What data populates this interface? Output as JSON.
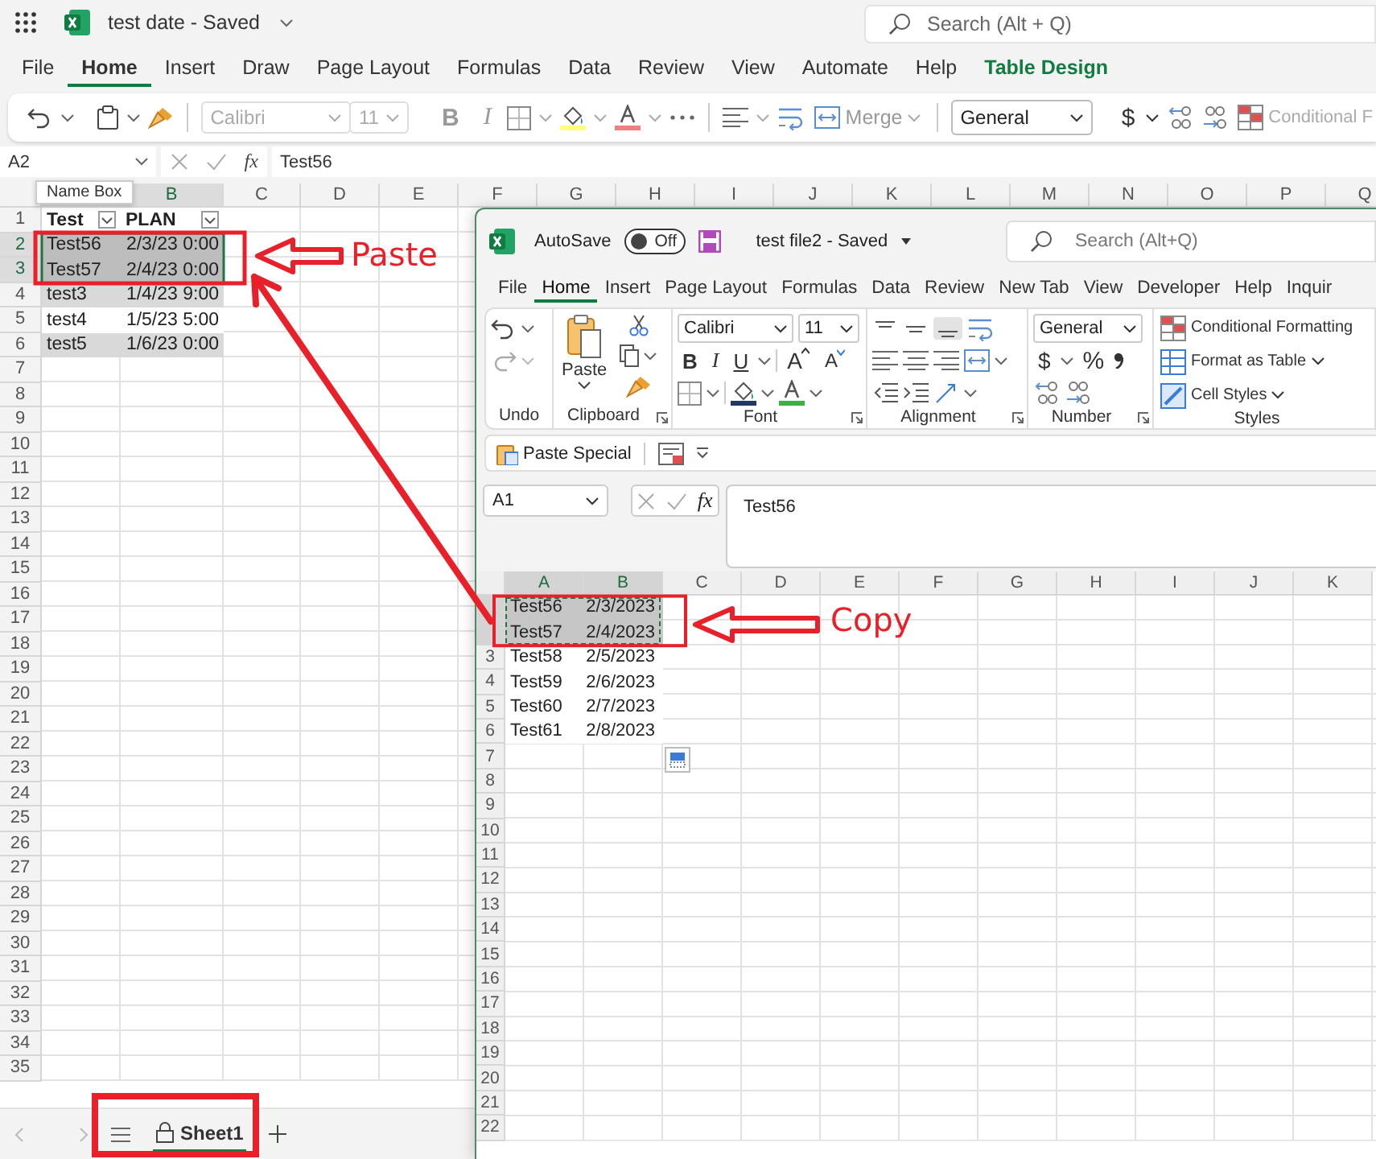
{
  "back_window": {
    "title": "test date - Saved",
    "search": {
      "placeholder": "Search (Alt + Q)"
    },
    "tabs": [
      {
        "label": "File",
        "selected": false,
        "kind": "normal"
      },
      {
        "label": "Home",
        "selected": true,
        "kind": "normal"
      },
      {
        "label": "Insert",
        "selected": false,
        "kind": "normal"
      },
      {
        "label": "Draw",
        "selected": false,
        "kind": "normal"
      },
      {
        "label": "Page Layout",
        "selected": false,
        "kind": "normal"
      },
      {
        "label": "Formulas",
        "selected": false,
        "kind": "normal"
      },
      {
        "label": "Data",
        "selected": false,
        "kind": "normal"
      },
      {
        "label": "Review",
        "selected": false,
        "kind": "normal"
      },
      {
        "label": "View",
        "selected": false,
        "kind": "normal"
      },
      {
        "label": "Automate",
        "selected": false,
        "kind": "normal"
      },
      {
        "label": "Help",
        "selected": false,
        "kind": "normal"
      },
      {
        "label": "Table Design",
        "selected": false,
        "kind": "contextual"
      }
    ],
    "toolbar": {
      "font": "Calibri",
      "size": "11",
      "font_buttons": [
        "B",
        "I"
      ],
      "merge": "Merge",
      "number_format": "General",
      "currency": "$",
      "conditional": "Conditional F"
    },
    "name_box": "A2",
    "function_label": "fx",
    "formula": "Test56",
    "tooltip": "Name Box",
    "sheet": {
      "columns": [
        {
          "selected": true
        },
        {
          "label": "B",
          "selected": true
        },
        {
          "label": "C",
          "selected": false
        },
        {
          "label": "D",
          "selected": false
        },
        {
          "label": "E",
          "selected": false
        },
        {
          "label": "F",
          "selected": false
        },
        {
          "label": "G",
          "selected": false
        },
        {
          "label": "H",
          "selected": false
        },
        {
          "label": "I",
          "selected": false
        },
        {
          "label": "J",
          "selected": false
        },
        {
          "label": "K",
          "selected": false
        },
        {
          "label": "L",
          "selected": false
        },
        {
          "label": "M",
          "selected": false
        },
        {
          "label": "N",
          "selected": false
        },
        {
          "label": "O",
          "selected": false
        },
        {
          "label": "P",
          "selected": false
        },
        {
          "label": "Q",
          "selected": false
        }
      ],
      "rows": [
        {
          "label": "1",
          "selected": false,
          "kind": "header",
          "cells": [
            "Test",
            "PLAN"
          ]
        },
        {
          "label": "2",
          "selected": true,
          "kind": "band",
          "cells": [
            "Test56",
            "2/3/23 0:00"
          ]
        },
        {
          "label": "3",
          "selected": true,
          "kind": "plain",
          "cells": [
            "Test57",
            "2/4/23 0:00"
          ]
        },
        {
          "label": "4",
          "selected": false,
          "kind": "band",
          "cells": [
            "test3",
            "1/4/23 9:00"
          ]
        },
        {
          "label": "5",
          "selected": false,
          "kind": "plain",
          "cells": [
            "test4",
            "1/5/23 5:00"
          ]
        },
        {
          "label": "6",
          "selected": false,
          "kind": "band",
          "cells": [
            "test5",
            "1/6/23 0:00"
          ]
        },
        {
          "label": "7",
          "selected": false
        },
        {
          "label": "8",
          "selected": false
        },
        {
          "label": "9",
          "selected": false
        },
        {
          "label": "10",
          "selected": false
        },
        {
          "label": "11",
          "selected": false
        },
        {
          "label": "12",
          "selected": false
        },
        {
          "label": "13",
          "selected": false
        },
        {
          "label": "14",
          "selected": false
        },
        {
          "label": "15",
          "selected": false
        },
        {
          "label": "16",
          "selected": false
        },
        {
          "label": "17",
          "selected": false
        },
        {
          "label": "18",
          "selected": false
        },
        {
          "label": "19",
          "selected": false
        },
        {
          "label": "20",
          "selected": false
        },
        {
          "label": "21",
          "selected": false
        },
        {
          "label": "22",
          "selected": false
        },
        {
          "label": "23",
          "selected": false
        },
        {
          "label": "24",
          "selected": false
        },
        {
          "label": "25",
          "selected": false
        },
        {
          "label": "26",
          "selected": false
        },
        {
          "label": "27",
          "selected": false
        },
        {
          "label": "28",
          "selected": false
        },
        {
          "label": "29",
          "selected": false
        },
        {
          "label": "30",
          "selected": false
        },
        {
          "label": "31",
          "selected": false
        },
        {
          "label": "32",
          "selected": false
        },
        {
          "label": "33",
          "selected": false
        },
        {
          "label": "34",
          "selected": false
        },
        {
          "label": "35",
          "selected": false
        }
      ]
    },
    "sheet_tabs": [
      {
        "label": "Sheet1",
        "selected": true
      }
    ]
  },
  "front_window": {
    "autosave": {
      "label": "AutoSave",
      "on": false,
      "state_label": "Off"
    },
    "title": "test file2 - Saved",
    "search": {
      "placeholder": "Search (Alt+Q)"
    },
    "tabs": [
      {
        "label": "File",
        "selected": false
      },
      {
        "label": "Home",
        "selected": true
      },
      {
        "label": "Insert",
        "selected": false
      },
      {
        "label": "Page Layout",
        "selected": false
      },
      {
        "label": "Formulas",
        "selected": false
      },
      {
        "label": "Data",
        "selected": false
      },
      {
        "label": "Review",
        "selected": false
      },
      {
        "label": "New Tab",
        "selected": false
      },
      {
        "label": "View",
        "selected": false
      },
      {
        "label": "Developer",
        "selected": false
      },
      {
        "label": "Help",
        "selected": false
      },
      {
        "label": "Inquir",
        "selected": false
      }
    ],
    "ribbon": {
      "paste": "Paste",
      "font": "Calibri",
      "size": "11",
      "font_buttons": [
        "B",
        "I",
        "U"
      ],
      "grow_font": "A",
      "shrink_font": "A",
      "number_format": "General",
      "currency": "$",
      "percent": "%",
      "styles": [
        "Conditional Formatting",
        "Format as Table",
        "Cell Styles"
      ],
      "groups": [
        "Undo",
        "Clipboard",
        "Font",
        "Alignment",
        "Number",
        "Styles"
      ]
    },
    "quick_access": {
      "paste_special": "Paste Special"
    },
    "name_box": "A1",
    "function_label": "fx",
    "formula": "Test56",
    "sheet": {
      "columns": [
        {
          "label": "A",
          "selected": true
        },
        {
          "label": "B",
          "selected": true
        },
        {
          "label": "C",
          "selected": false
        },
        {
          "label": "D",
          "selected": false
        },
        {
          "label": "E",
          "selected": false
        },
        {
          "label": "F",
          "selected": false
        },
        {
          "label": "G",
          "selected": false
        },
        {
          "label": "H",
          "selected": false
        },
        {
          "label": "I",
          "selected": false
        },
        {
          "label": "J",
          "selected": false
        },
        {
          "label": "K",
          "selected": false
        }
      ],
      "rows": [
        {
          "selected": true,
          "cells": [
            "Test56",
            "2/3/2023"
          ]
        },
        {
          "selected": true,
          "cells": [
            "Test57",
            "2/4/2023"
          ]
        },
        {
          "label": "3",
          "selected": false,
          "cells": [
            "Test58",
            "2/5/2023"
          ]
        },
        {
          "label": "4",
          "selected": false,
          "cells": [
            "Test59",
            "2/6/2023"
          ]
        },
        {
          "label": "5",
          "selected": false,
          "cells": [
            "Test60",
            "2/7/2023"
          ]
        },
        {
          "label": "6",
          "selected": false,
          "cells": [
            "Test61",
            "2/8/2023"
          ]
        },
        {
          "label": "7",
          "selected": false
        },
        {
          "label": "8",
          "selected": false
        },
        {
          "label": "9",
          "selected": false
        },
        {
          "label": "10",
          "selected": false
        },
        {
          "label": "11",
          "selected": false
        },
        {
          "label": "12",
          "selected": false
        },
        {
          "label": "13",
          "selected": false
        },
        {
          "label": "14",
          "selected": false
        },
        {
          "label": "15",
          "selected": false
        },
        {
          "label": "16",
          "selected": false
        },
        {
          "label": "17",
          "selected": false
        },
        {
          "label": "18",
          "selected": false
        },
        {
          "label": "19",
          "selected": false
        },
        {
          "label": "20",
          "selected": false
        },
        {
          "label": "21",
          "selected": false
        },
        {
          "label": "22",
          "selected": false
        }
      ]
    }
  },
  "annotations": [
    {
      "text": "Paste"
    },
    {
      "text": "Copy"
    }
  ]
}
